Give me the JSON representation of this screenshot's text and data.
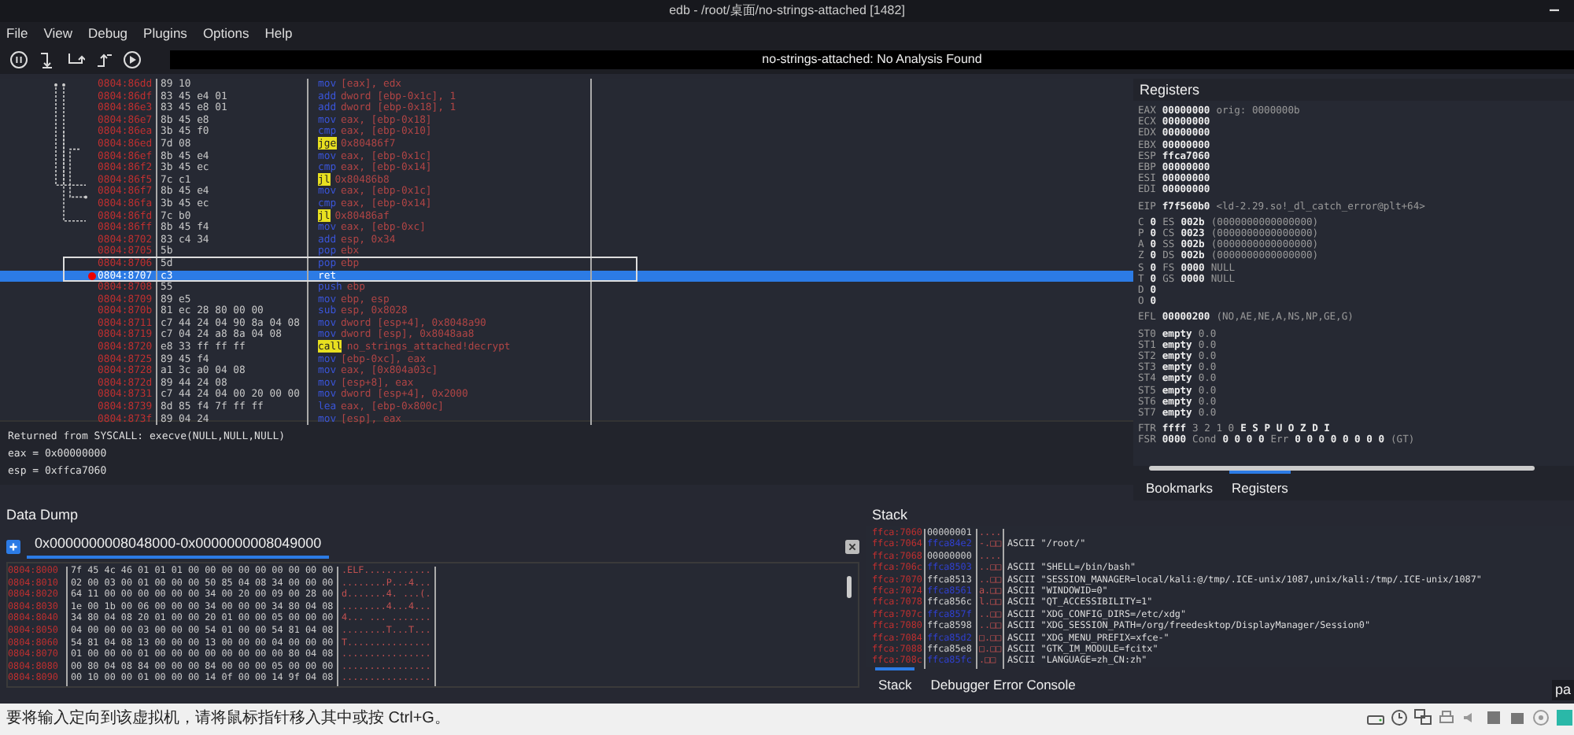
{
  "window": {
    "title": "edb - /root/桌面/no-strings-attached [1482]"
  },
  "menu": [
    "File",
    "View",
    "Debug",
    "Plugins",
    "Options",
    "Help"
  ],
  "toolbar": [
    {
      "kind": "pause"
    },
    {
      "kind": "step-into"
    },
    {
      "kind": "step-over"
    },
    {
      "kind": "step-out"
    },
    {
      "kind": "run"
    }
  ],
  "analysis_banner": "no-strings-attached: No Analysis Found",
  "disassembly": {
    "rows": [
      {
        "address": "0804:86dd",
        "bytes": "89 10",
        "mnemonic": "mov",
        "operands": "[eax], edx",
        "kind": "plain",
        "selected": false,
        "breakpoint": false
      },
      {
        "address": "0804:86df",
        "bytes": "83 45 e4 01",
        "mnemonic": "add",
        "operands": "dword [ebp-0x1c], 1",
        "kind": "plain",
        "selected": false,
        "breakpoint": false
      },
      {
        "address": "0804:86e3",
        "bytes": "83 45 e8 01",
        "mnemonic": "add",
        "operands": "dword [ebp-0x18], 1",
        "kind": "plain",
        "selected": false,
        "breakpoint": false
      },
      {
        "address": "0804:86e7",
        "bytes": "8b 45 e8",
        "mnemonic": "mov",
        "operands": "eax, [ebp-0x18]",
        "kind": "plain",
        "selected": false,
        "breakpoint": false
      },
      {
        "address": "0804:86ea",
        "bytes": "3b 45 f0",
        "mnemonic": "cmp",
        "operands": "eax, [ebp-0x10]",
        "kind": "plain",
        "selected": false,
        "breakpoint": false
      },
      {
        "address": "0804:86ed",
        "bytes": "7d 08",
        "mnemonic": "jge",
        "operands": "0x80486f7",
        "kind": "branch",
        "selected": false,
        "breakpoint": false
      },
      {
        "address": "0804:86ef",
        "bytes": "8b 45 e4",
        "mnemonic": "mov",
        "operands": "eax, [ebp-0x1c]",
        "kind": "plain",
        "selected": false,
        "breakpoint": false
      },
      {
        "address": "0804:86f2",
        "bytes": "3b 45 ec",
        "mnemonic": "cmp",
        "operands": "eax, [ebp-0x14]",
        "kind": "plain",
        "selected": false,
        "breakpoint": false
      },
      {
        "address": "0804:86f5",
        "bytes": "7c c1",
        "mnemonic": "jl",
        "operands": "0x80486b8",
        "kind": "branch",
        "selected": false,
        "breakpoint": false
      },
      {
        "address": "0804:86f7",
        "bytes": "8b 45 e4",
        "mnemonic": "mov",
        "operands": "eax, [ebp-0x1c]",
        "kind": "plain",
        "selected": false,
        "breakpoint": false
      },
      {
        "address": "0804:86fa",
        "bytes": "3b 45 ec",
        "mnemonic": "cmp",
        "operands": "eax, [ebp-0x14]",
        "kind": "plain",
        "selected": false,
        "breakpoint": false
      },
      {
        "address": "0804:86fd",
        "bytes": "7c b0",
        "mnemonic": "jl",
        "operands": "0x80486af",
        "kind": "branch",
        "selected": false,
        "breakpoint": false
      },
      {
        "address": "0804:86ff",
        "bytes": "8b 45 f4",
        "mnemonic": "mov",
        "operands": "eax, [ebp-0xc]",
        "kind": "plain",
        "selected": false,
        "breakpoint": false
      },
      {
        "address": "0804:8702",
        "bytes": "83 c4 34",
        "mnemonic": "add",
        "operands": "esp, 0x34",
        "kind": "plain",
        "selected": false,
        "breakpoint": false
      },
      {
        "address": "0804:8705",
        "bytes": "5b",
        "mnemonic": "pop",
        "operands": "ebx",
        "kind": "plain",
        "selected": false,
        "breakpoint": false
      },
      {
        "address": "0804:8706",
        "bytes": "5d",
        "mnemonic": "pop",
        "operands": "ebp",
        "kind": "plain",
        "selected": false,
        "breakpoint": false
      },
      {
        "address": "0804:8707",
        "bytes": "c3",
        "mnemonic": "ret",
        "operands": "",
        "kind": "plain",
        "selected": true,
        "breakpoint": true
      },
      {
        "address": "0804:8708",
        "bytes": "55",
        "mnemonic": "push",
        "operands": "ebp",
        "kind": "plain",
        "selected": false,
        "breakpoint": false
      },
      {
        "address": "0804:8709",
        "bytes": "89 e5",
        "mnemonic": "mov",
        "operands": "ebp, esp",
        "kind": "plain",
        "selected": false,
        "breakpoint": false
      },
      {
        "address": "0804:870b",
        "bytes": "81 ec 28 80 00 00",
        "mnemonic": "sub",
        "operands": "esp, 0x8028",
        "kind": "plain",
        "selected": false,
        "breakpoint": false
      },
      {
        "address": "0804:8711",
        "bytes": "c7 44 24 04 90 8a 04 08",
        "mnemonic": "mov",
        "operands": "dword [esp+4], 0x8048a90",
        "kind": "plain",
        "selected": false,
        "breakpoint": false
      },
      {
        "address": "0804:8719",
        "bytes": "c7 04 24 a8 8a 04 08",
        "mnemonic": "mov",
        "operands": "dword [esp], 0x8048aa8",
        "kind": "plain",
        "selected": false,
        "breakpoint": false
      },
      {
        "address": "0804:8720",
        "bytes": "e8 33 ff ff ff",
        "mnemonic": "call",
        "operands": "no_strings_attached!decrypt",
        "kind": "branch",
        "selected": false,
        "breakpoint": false
      },
      {
        "address": "0804:8725",
        "bytes": "89 45 f4",
        "mnemonic": "mov",
        "operands": "[ebp-0xc], eax",
        "kind": "plain",
        "selected": false,
        "breakpoint": false
      },
      {
        "address": "0804:8728",
        "bytes": "a1 3c a0 04 08",
        "mnemonic": "mov",
        "operands": "eax, [0x804a03c]",
        "kind": "plain",
        "selected": false,
        "breakpoint": false
      },
      {
        "address": "0804:872d",
        "bytes": "89 44 24 08",
        "mnemonic": "mov",
        "operands": "[esp+8], eax",
        "kind": "plain",
        "selected": false,
        "breakpoint": false
      },
      {
        "address": "0804:8731",
        "bytes": "c7 44 24 04 00 20 00 00",
        "mnemonic": "mov",
        "operands": "dword [esp+4], 0x2000",
        "kind": "plain",
        "selected": false,
        "breakpoint": false
      },
      {
        "address": "0804:8739",
        "bytes": "8d 85 f4 7f ff ff",
        "mnemonic": "lea",
        "operands": "eax, [ebp-0x800c]",
        "kind": "plain",
        "selected": false,
        "breakpoint": false
      },
      {
        "address": "0804:873f",
        "bytes": "89 04 24",
        "mnemonic": "mov",
        "operands": "[esp], eax",
        "kind": "plain",
        "selected": false,
        "breakpoint": false
      }
    ]
  },
  "syscall_info": [
    "Returned from SYSCALL: execve(NULL,NULL,NULL)",
    "eax = 0x00000000",
    "esp = 0xffca7060"
  ],
  "registers": {
    "title": "Registers",
    "groups": [
      [
        [
          "EAX",
          "00000000",
          "orig: 0000000b"
        ],
        [
          "ECX",
          "00000000"
        ],
        [
          "EDX",
          "00000000"
        ],
        [
          "EBX",
          "00000000"
        ],
        [
          "ESP",
          "ffca7060"
        ],
        [
          "EBP",
          "00000000"
        ],
        [
          "ESI",
          "00000000"
        ],
        [
          "EDI",
          "00000000"
        ]
      ],
      [
        [
          "EIP",
          "f7f560b0",
          "<ld-2.29.so!_dl_catch_error@plt+64>"
        ]
      ],
      [
        [
          "C",
          "0",
          "ES",
          "002b",
          "(0000000000000000)"
        ],
        [
          "P",
          "0",
          "CS",
          "0023",
          "(0000000000000000)"
        ],
        [
          "A",
          "0",
          "SS",
          "002b",
          "(0000000000000000)"
        ],
        [
          "Z",
          "0",
          "DS",
          "002b",
          "(0000000000000000)"
        ],
        [
          "S",
          "0",
          "FS",
          "0000",
          "NULL"
        ],
        [
          "T",
          "0",
          "GS",
          "0000",
          "NULL"
        ],
        [
          "D",
          "0"
        ],
        [
          "O",
          "0"
        ]
      ],
      [
        [
          "EFL",
          "00000200",
          "(NO,AE,NE,A,NS,NP,GE,G)"
        ]
      ],
      [
        [
          "ST0",
          "empty",
          "0.0"
        ],
        [
          "ST1",
          "empty",
          "0.0"
        ],
        [
          "ST2",
          "empty",
          "0.0"
        ],
        [
          "ST3",
          "empty",
          "0.0"
        ],
        [
          "ST4",
          "empty",
          "0.0"
        ],
        [
          "ST5",
          "empty",
          "0.0"
        ],
        [
          "ST6",
          "empty",
          "0.0"
        ],
        [
          "ST7",
          "empty",
          "0.0"
        ]
      ],
      [
        [
          "FTR",
          "ffff",
          "3 2 1 0",
          "E S P U O Z D I"
        ],
        [
          "FSR",
          "0000",
          "Cond",
          "0 0 0 0",
          "Err",
          "0 0 0 0 0 0 0 0",
          "(GT)"
        ]
      ]
    ],
    "tabs": [
      {
        "label": "Bookmarks",
        "selected": false
      },
      {
        "label": "Registers",
        "selected": true
      }
    ]
  },
  "data_dump": {
    "title": "Data Dump",
    "tab": "0x0000000008048000-0x0000000008049000",
    "rows": [
      {
        "address": "0804:8000",
        "hex": "7f 45 4c 46 01 01 01 00 00 00 00 00 00 00 00 00",
        "ascii": ".ELF............"
      },
      {
        "address": "0804:8010",
        "hex": "02 00 03 00 01 00 00 00 50 85 04 08 34 00 00 00",
        "ascii": "........P...4..."
      },
      {
        "address": "0804:8020",
        "hex": "64 11 00 00 00 00 00 00 34 00 20 00 09 00 28 00",
        "ascii": "d.......4. ...(."
      },
      {
        "address": "0804:8030",
        "hex": "1e 00 1b 00 06 00 00 00 34 00 00 00 34 80 04 08",
        "ascii": "........4...4..."
      },
      {
        "address": "0804:8040",
        "hex": "34 80 04 08 20 01 00 00 20 01 00 00 05 00 00 00",
        "ascii": "4... ... ......."
      },
      {
        "address": "0804:8050",
        "hex": "04 00 00 00 03 00 00 00 54 01 00 00 54 81 04 08",
        "ascii": "........T...T..."
      },
      {
        "address": "0804:8060",
        "hex": "54 81 04 08 13 00 00 00 13 00 00 00 04 00 00 00",
        "ascii": "T..............."
      },
      {
        "address": "0804:8070",
        "hex": "01 00 00 00 01 00 00 00 00 00 00 00 00 80 04 08",
        "ascii": "................"
      },
      {
        "address": "0804:8080",
        "hex": "00 80 04 08 84 00 00 00 84 00 00 00 05 00 00 00",
        "ascii": "................"
      },
      {
        "address": "0804:8090",
        "hex": "00 10 00 00 01 00 00 00 14 0f 00 00 14 9f 04 08",
        "ascii": "................"
      }
    ]
  },
  "stack": {
    "title": "Stack",
    "rows": [
      {
        "address": "ffca:7060",
        "value": "00000001",
        "color": "#d0d0d0",
        "chars": "....",
        "comment": ""
      },
      {
        "address": "ffca:7064",
        "value": "ffca84e2",
        "color": "#3040d0",
        "chars": "-.□□",
        "comment": "ASCII \"/root/\""
      },
      {
        "address": "ffca:7068",
        "value": "00000000",
        "color": "#d0d0d0",
        "chars": "....",
        "comment": ""
      },
      {
        "address": "ffca:706c",
        "value": "ffca8503",
        "color": "#3040d0",
        "chars": "..□□",
        "comment": "ASCII \"SHELL=/bin/bash\""
      },
      {
        "address": "ffca:7070",
        "value": "ffca8513",
        "color": "#d0d0d0",
        "chars": "..□□",
        "comment": "ASCII \"SESSION_MANAGER=local/kali:@/tmp/.ICE-unix/1087,unix/kali:/tmp/.ICE-unix/1087\""
      },
      {
        "address": "ffca:7074",
        "value": "ffca8561",
        "color": "#3040d0",
        "chars": "a.□□",
        "comment": "ASCII \"WINDOWID=0\""
      },
      {
        "address": "ffca:7078",
        "value": "ffca856c",
        "color": "#d0d0d0",
        "chars": "l.□□",
        "comment": "ASCII \"QT_ACCESSIBILITY=1\""
      },
      {
        "address": "ffca:707c",
        "value": "ffca857f",
        "color": "#3040d0",
        "chars": "..□□",
        "comment": "ASCII \"XDG_CONFIG_DIRS=/etc/xdg\""
      },
      {
        "address": "ffca:7080",
        "value": "ffca8598",
        "color": "#d0d0d0",
        "chars": "..□□",
        "comment": "ASCII \"XDG_SESSION_PATH=/org/freedesktop/DisplayManager/Session0\""
      },
      {
        "address": "ffca:7084",
        "value": "ffca85d2",
        "color": "#3040d0",
        "chars": "□.□□",
        "comment": "ASCII \"XDG_MENU_PREFIX=xfce-\""
      },
      {
        "address": "ffca:7088",
        "value": "ffca85e8",
        "color": "#d0d0d0",
        "chars": "□.□□",
        "comment": "ASCII \"GTK_IM_MODULE=fcitx\""
      },
      {
        "address": "ffca:708c",
        "value": "ffca85fc",
        "color": "#3040d0",
        "chars": " .□□",
        "comment": "ASCII \"LANGUAGE=zh_CN:zh\""
      }
    ],
    "tabs": [
      {
        "label": "Stack",
        "selected": true
      },
      {
        "label": "Debugger Error Console",
        "selected": false
      }
    ]
  },
  "status_bar": {
    "message": "要将输入定向到该虚拟机，请将鼠标指针移入其中或按 Ctrl+G。",
    "tray_text": "pa"
  }
}
